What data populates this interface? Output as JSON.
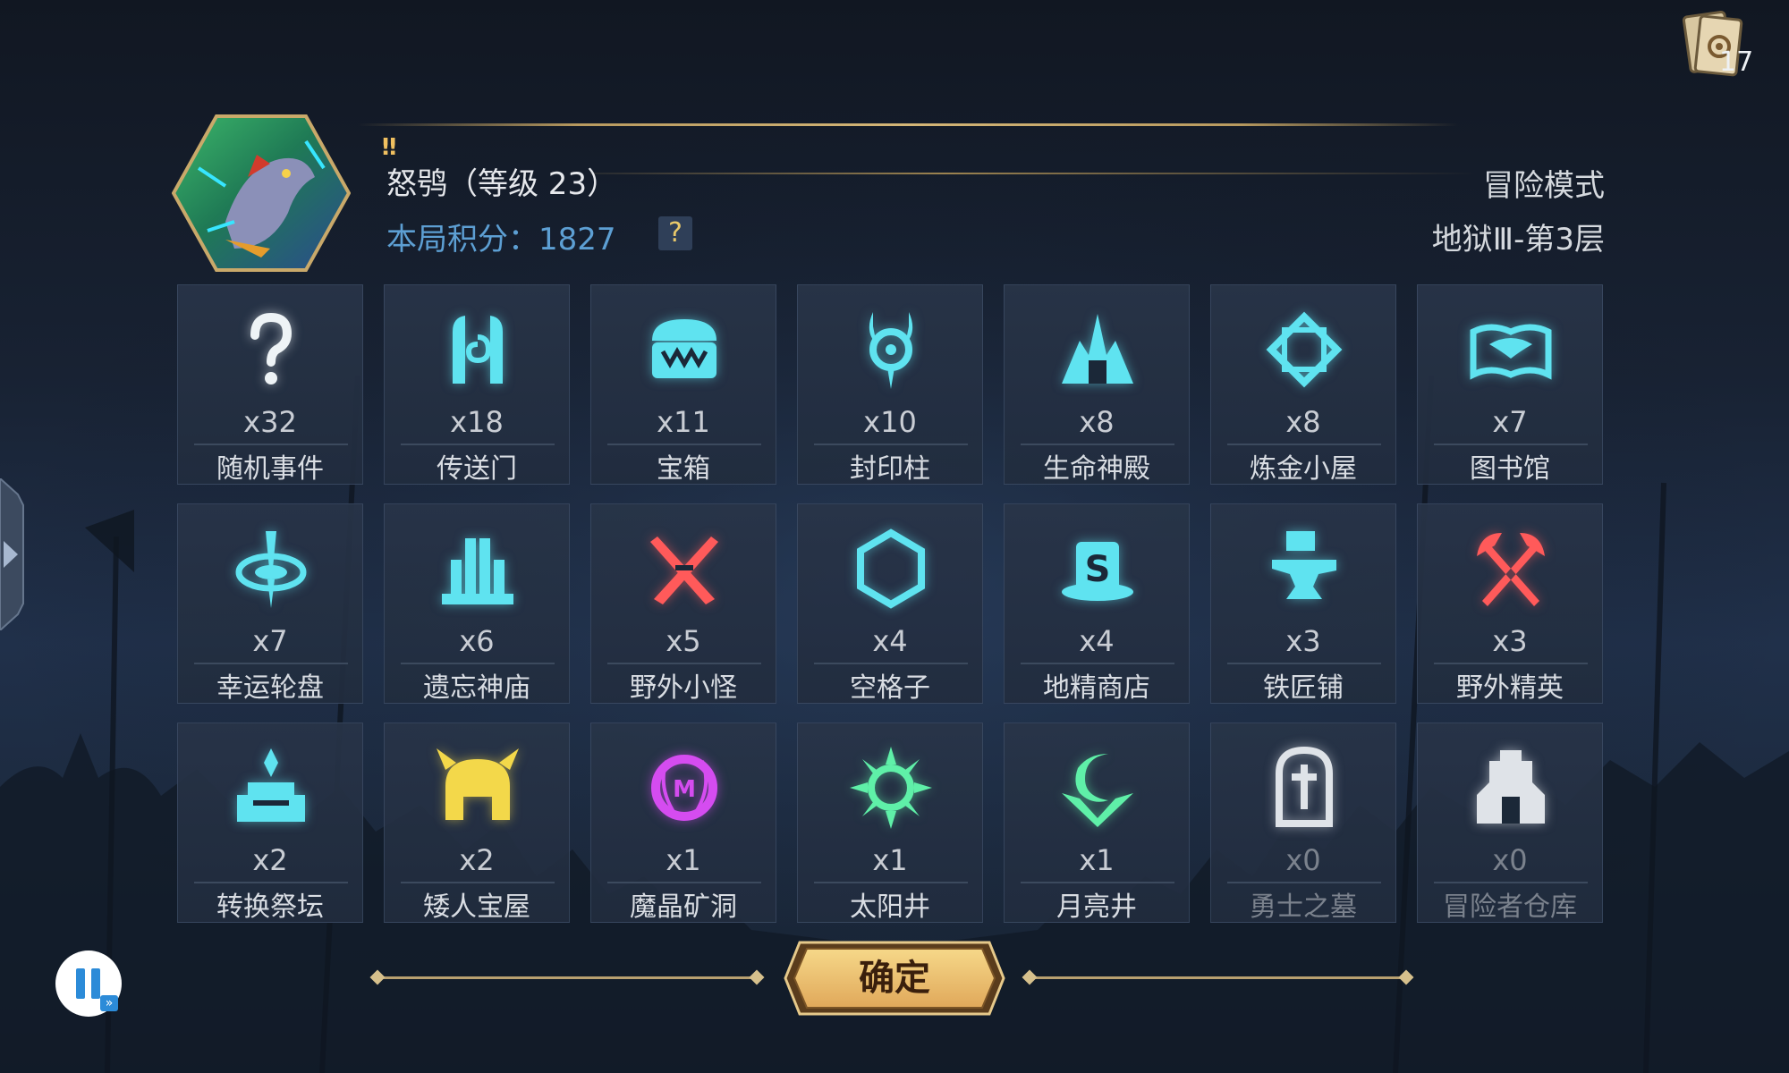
{
  "hud": {
    "card_count": "17",
    "card_icon": "tarot-card-icon"
  },
  "header": {
    "marker": "‼",
    "hero_name": "怒鸮（等级 23）",
    "score_label": "本局积分：1827",
    "help_label": "?",
    "mode": "冒险模式",
    "level": "地狱Ⅲ-第3层"
  },
  "cells": [
    {
      "count": "x32",
      "name": "随机事件",
      "icon": "question-icon",
      "color": "#eef3f6",
      "dim": false
    },
    {
      "count": "x18",
      "name": "传送门",
      "icon": "portal-icon",
      "color": "#5fe3f0",
      "dim": false
    },
    {
      "count": "x11",
      "name": "宝箱",
      "icon": "chest-icon",
      "color": "#5fe3f0",
      "dim": false
    },
    {
      "count": "x10",
      "name": "封印柱",
      "icon": "seal-pillar-icon",
      "color": "#5fe3f0",
      "dim": false
    },
    {
      "count": "x8",
      "name": "生命神殿",
      "icon": "life-temple-icon",
      "color": "#5fe3f0",
      "dim": false
    },
    {
      "count": "x8",
      "name": "炼金小屋",
      "icon": "alchemy-icon",
      "color": "#5fe3f0",
      "dim": false
    },
    {
      "count": "x7",
      "name": "图书馆",
      "icon": "library-icon",
      "color": "#5fe3f0",
      "dim": false
    },
    {
      "count": "x7",
      "name": "幸运轮盘",
      "icon": "lucky-wheel-icon",
      "color": "#5fe3f0",
      "dim": false
    },
    {
      "count": "x6",
      "name": "遗忘神庙",
      "icon": "forgotten-temple-icon",
      "color": "#5fe3f0",
      "dim": false
    },
    {
      "count": "x5",
      "name": "野外小怪",
      "icon": "crossed-swords-icon",
      "color": "#ff5a5a",
      "dim": false
    },
    {
      "count": "x4",
      "name": "空格子",
      "icon": "hexagon-icon",
      "color": "#5fe3f0",
      "dim": false
    },
    {
      "count": "x4",
      "name": "地精商店",
      "icon": "goblin-shop-icon",
      "color": "#5fe3f0",
      "dim": false
    },
    {
      "count": "x3",
      "name": "铁匠铺",
      "icon": "anvil-icon",
      "color": "#5fe3f0",
      "dim": false
    },
    {
      "count": "x3",
      "name": "野外精英",
      "icon": "crossed-axes-icon",
      "color": "#ff5a5a",
      "dim": false
    },
    {
      "count": "x2",
      "name": "转换祭坛",
      "icon": "altar-icon",
      "color": "#5fe3f0",
      "dim": false
    },
    {
      "count": "x2",
      "name": "矮人宝屋",
      "icon": "dwarf-helmet-icon",
      "color": "#f3d84a",
      "dim": false
    },
    {
      "count": "x1",
      "name": "魔晶矿洞",
      "icon": "crystal-mine-icon",
      "color": "#d54cf0",
      "dim": false
    },
    {
      "count": "x1",
      "name": "太阳井",
      "icon": "sun-well-icon",
      "color": "#5ff0a8",
      "dim": false
    },
    {
      "count": "x1",
      "name": "月亮井",
      "icon": "moon-well-icon",
      "color": "#5ff0a8",
      "dim": false
    },
    {
      "count": "x0",
      "name": "勇士之墓",
      "icon": "tomb-icon",
      "color": "#dfe3e8",
      "dim": true
    },
    {
      "count": "x0",
      "name": "冒险者仓库",
      "icon": "warehouse-icon",
      "color": "#dfe3e8",
      "dim": true
    }
  ],
  "confirm_label": "确定"
}
